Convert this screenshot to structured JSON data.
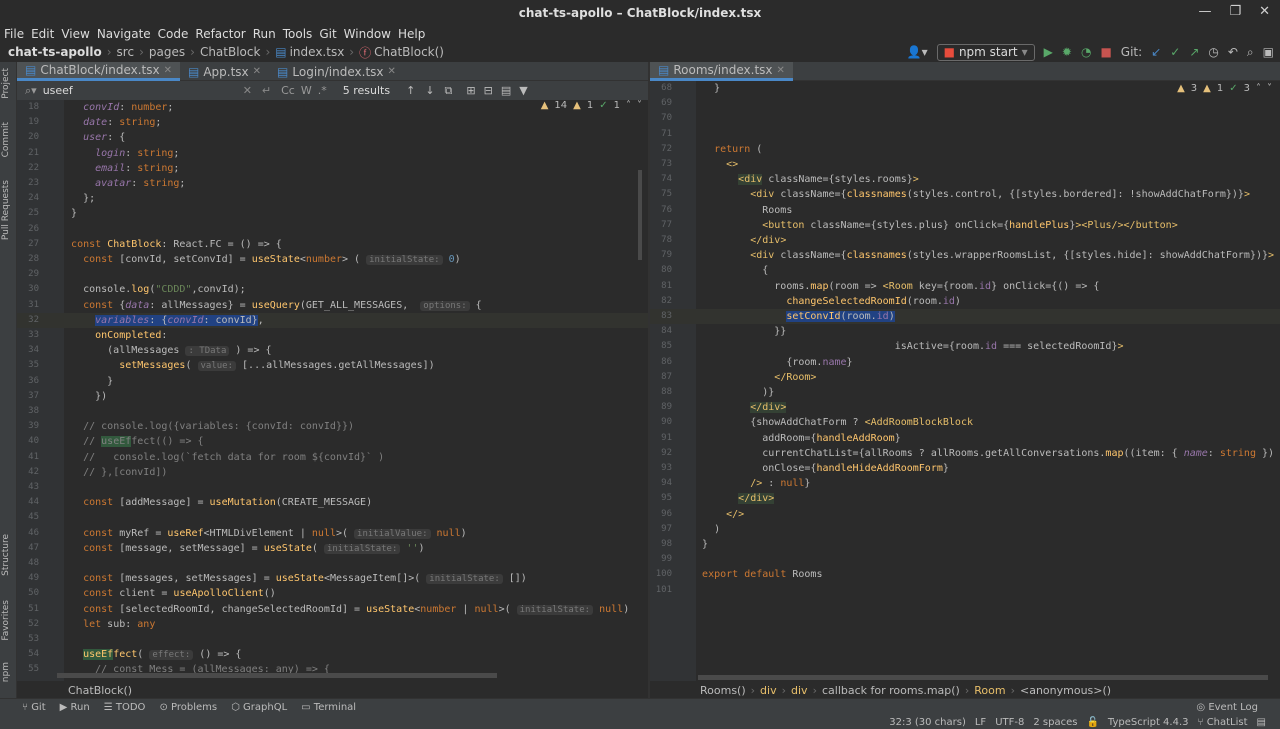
{
  "window": {
    "title": "chat-ts-apollo – ChatBlock/index.tsx"
  },
  "menu": [
    "File",
    "Edit",
    "View",
    "Navigate",
    "Code",
    "Refactor",
    "Run",
    "Tools",
    "Git",
    "Window",
    "Help"
  ],
  "breadcrumb": {
    "project": "chat-ts-apollo",
    "items": [
      "src",
      "pages",
      "ChatBlock",
      "index.tsx",
      "ChatBlock()"
    ]
  },
  "toolbar": {
    "run_config": "npm start",
    "git_label": "Git:"
  },
  "left_tools": [
    "Project",
    "Commit",
    "Pull Requests",
    "Structure",
    "Favorites",
    "npm"
  ],
  "left_tabs": [
    "ChatBlock/index.tsx",
    "App.tsx",
    "Login/index.tsx"
  ],
  "right_tabs": [
    "Rooms/index.tsx"
  ],
  "search": {
    "value": "useef",
    "results": "5 results",
    "cc": "Cc",
    "w": "W"
  },
  "left_indicators": {
    "warnings": "14",
    "weak": "1",
    "ok": "1"
  },
  "right_indicators": {
    "warnings": "3",
    "weak": "1",
    "ok": "3"
  },
  "left_code": [
    {
      "n": "18",
      "h": "    <span class='prop'><i>convId</i></span>: <span class='kw'>number</span>;"
    },
    {
      "n": "19",
      "h": "    <span class='prop'><i>date</i></span>: <span class='kw'>string</span>;"
    },
    {
      "n": "20",
      "h": "    <span class='prop'><i>user</i></span>: {"
    },
    {
      "n": "21",
      "h": "      <span class='prop'><i>login</i></span>: <span class='kw'>string</span>;"
    },
    {
      "n": "22",
      "h": "      <span class='prop'><i>email</i></span>: <span class='kw'>string</span>;"
    },
    {
      "n": "23",
      "h": "      <span class='prop'><i>avatar</i></span>: <span class='kw'>string</span>;"
    },
    {
      "n": "24",
      "h": "    };"
    },
    {
      "n": "25",
      "h": "  }"
    },
    {
      "n": "26",
      "h": ""
    },
    {
      "n": "27",
      "h": "  <span class='kw'>const</span> <span class='fn'>ChatBlock</span>: React.FC = () => {"
    },
    {
      "n": "28",
      "h": "    <span class='kw'>const</span> [convId, setConvId] = <span class='fn'>useState</span>&lt;<span class='kw'>number</span>> ( <span class='hint'>initialState:</span> <span class='num'>0</span>)"
    },
    {
      "n": "29",
      "h": ""
    },
    {
      "n": "30",
      "h": "    console.<span class='fn'>log</span>(<span class='str'>\"CDDD\"</span>,convId);"
    },
    {
      "n": "31",
      "h": "    <span class='kw'>const</span> {<span class='prop'><i>data</i></span>: allMessages} = <span class='fn'>useQuery</span>(GET_ALL_MESSAGES,  <span class='hint'>options:</span> {"
    },
    {
      "n": "32",
      "h": "      <span style='background:#214283'><span class='prop'><i>variables</i></span>: {<span class='prop'><i>convId</i></span>: convId}</span>,"
    },
    {
      "n": "33",
      "h": "      <span class='fn'>onCompleted</span>:"
    },
    {
      "n": "34",
      "h": "        (allMessages <span class='hint'>: TData</span> ) => {"
    },
    {
      "n": "35",
      "h": "          <span class='fn'>setMessages</span>( <span class='hint'>value:</span> [...allMessages.getAllMessages])"
    },
    {
      "n": "36",
      "h": "        }"
    },
    {
      "n": "37",
      "h": "      })"
    },
    {
      "n": "38",
      "h": ""
    },
    {
      "n": "39",
      "h": "    <span class='cm'>// console.log({variables: {convId: convId}})</span>"
    },
    {
      "n": "40",
      "h": "    <span class='cm'>// <span style='background:#32593d'>useEf</span>fect(() => {</span>"
    },
    {
      "n": "41",
      "h": "    <span class='cm'>//   console.log(`fetch data for room ${convId}` )</span>"
    },
    {
      "n": "42",
      "h": "    <span class='cm'>// },[convId])</span>"
    },
    {
      "n": "43",
      "h": ""
    },
    {
      "n": "44",
      "h": "    <span class='kw'>const</span> [addMessage] = <span class='fn'>useMutation</span>(CREATE_MESSAGE)"
    },
    {
      "n": "45",
      "h": ""
    },
    {
      "n": "46",
      "h": "    <span class='kw'>const</span> myRef = <span class='fn'>useRef</span>&lt;HTMLDivElement | <span class='kw'>null</span>>( <span class='hint'>initialValue:</span> <span class='kw'>null</span>)"
    },
    {
      "n": "47",
      "h": "    <span class='kw'>const</span> [message, setMessage] = <span class='fn'>useState</span>( <span class='hint'>initialState:</span> <span class='str'>''</span>)"
    },
    {
      "n": "48",
      "h": ""
    },
    {
      "n": "49",
      "h": "    <span class='kw'>const</span> [messages, setMessages] = <span class='fn'>useState</span>&lt;MessageItem[]>( <span class='hint'>initialState:</span> [])"
    },
    {
      "n": "50",
      "h": "    <span class='kw'>const</span> client = <span class='fn'>useApolloClient</span>()"
    },
    {
      "n": "51",
      "h": "    <span class='kw'>const</span> [selectedRoomId, changeSelectedRoomId] = <span class='fn'>useState</span>&lt;<span class='kw'>number</span> | <span class='kw'>null</span>>( <span class='hint'>initialState:</span> <span class='kw'>null</span>)"
    },
    {
      "n": "52",
      "h": "    <span class='kw'>let</span> sub: <span class='kw'>any</span>"
    },
    {
      "n": "53",
      "h": ""
    },
    {
      "n": "54",
      "h": "    <span style='background:#32593d'><span class='fn'>useEf</span></span><span class='fn'>fect</span>( <span class='hint'>effect:</span> () => {"
    },
    {
      "n": "55",
      "h": "      <span class='cm'>// const Mess = (allMessages: any) => {</span>"
    }
  ],
  "right_code": [
    {
      "n": "68",
      "h": "    }"
    },
    {
      "n": "69",
      "h": ""
    },
    {
      "n": "70",
      "h": ""
    },
    {
      "n": "71",
      "h": ""
    },
    {
      "n": "72",
      "h": "    <span class='kw'>return</span> ("
    },
    {
      "n": "73",
      "h": "      <span class='tag'>&lt;></span>"
    },
    {
      "n": "74",
      "h": "        <span style='background:#344134'><span class='tag'>&lt;div</span></span> className={styles.rooms}<span class='tag'>></span>"
    },
    {
      "n": "75",
      "h": "          <span class='tag'>&lt;div</span> className={<span class='fn'>classnames</span>(styles.control, {[styles.bordered]: !showAddChatForm})}<span class='tag'>></span>"
    },
    {
      "n": "76",
      "h": "            Rooms"
    },
    {
      "n": "77",
      "h": "            <span class='tag'>&lt;button</span> className={styles.plus} onClick={<span class='fn'>handlePlus</span>}<span class='tag'>>&lt;Plus/>&lt;/button></span>"
    },
    {
      "n": "78",
      "h": "          <span class='tag'>&lt;/div></span>"
    },
    {
      "n": "79",
      "h": "          <span class='tag'>&lt;div</span> className={<span class='fn'>classnames</span>(styles.wrapperRoomsList, {[styles.hide]: showAddChatForm})}<span class='tag'>></span>"
    },
    {
      "n": "80",
      "h": "            {"
    },
    {
      "n": "81",
      "h": "              rooms.<span class='fn'>map</span>(room => <span class='tag'>&lt;Room</span> key={room.<span class='prop'>id</span>} onClick={() => {"
    },
    {
      "n": "82",
      "h": "                <span class='fn'>changeSelectedRoomId</span>(room.<span class='prop'>id</span>)"
    },
    {
      "n": "83",
      "h": "                <span style='background:#214283'><span class='fn'>setConvId</span>(room.<span class='prop'>id</span>)</span>"
    },
    {
      "n": "84",
      "h": "              }}"
    },
    {
      "n": "85",
      "h": "                                  isActive={room.<span class='prop'>id</span> === selectedRoomId}<span class='tag'>></span>"
    },
    {
      "n": "86",
      "h": "                {room.<span class='prop'>name</span>}"
    },
    {
      "n": "87",
      "h": "              <span class='tag'>&lt;/Room></span>"
    },
    {
      "n": "88",
      "h": "            )}"
    },
    {
      "n": "89",
      "h": "          <span style='background:#344134'><span class='tag'>&lt;/div></span></span>"
    },
    {
      "n": "90",
      "h": "          {showAddChatForm ? <span class='tag'>&lt;AddRoomBlockBlock</span>"
    },
    {
      "n": "91",
      "h": "            addRoom={<span class='fn'>handleAddRoom</span>}"
    },
    {
      "n": "92",
      "h": "            currentChatList={allRooms ? allRooms.getAllConversations.<span class='fn'>map</span>((item: { <span class='prop'><i>name</i></span>: <span class='kw'>string</span> }) => item.<span class='prop'>n</span>"
    },
    {
      "n": "93",
      "h": "            onClose={<span class='fn'>handleHideAddRoomForm</span>}"
    },
    {
      "n": "94",
      "h": "          <span class='tag'>/></span> : <span class='kw'>null</span>}"
    },
    {
      "n": "95",
      "h": "        <span style='background:#344134'><span class='tag'>&lt;/div></span></span>"
    },
    {
      "n": "96",
      "h": "      <span class='tag'>&lt;/></span>"
    },
    {
      "n": "97",
      "h": "    )"
    },
    {
      "n": "98",
      "h": "  }"
    },
    {
      "n": "99",
      "h": ""
    },
    {
      "n": "100",
      "h": "  <span class='kw'>export default</span> Rooms"
    },
    {
      "n": "101",
      "h": ""
    }
  ],
  "left_breadcrumb": "ChatBlock()",
  "right_breadcrumb": [
    "Rooms()",
    "div",
    "div",
    "callback for rooms.map()",
    "Room",
    "<anonymous>()"
  ],
  "bottom_tools": [
    "Git",
    "Run",
    "TODO",
    "Problems",
    "GraphQL",
    "Terminal"
  ],
  "event_log": "Event Log",
  "status": {
    "position": "32:3 (30 chars)",
    "line_sep": "LF",
    "encoding": "UTF-8",
    "indent": "2 spaces",
    "ts": "TypeScript 4.4.3",
    "branch": "ChatList"
  }
}
